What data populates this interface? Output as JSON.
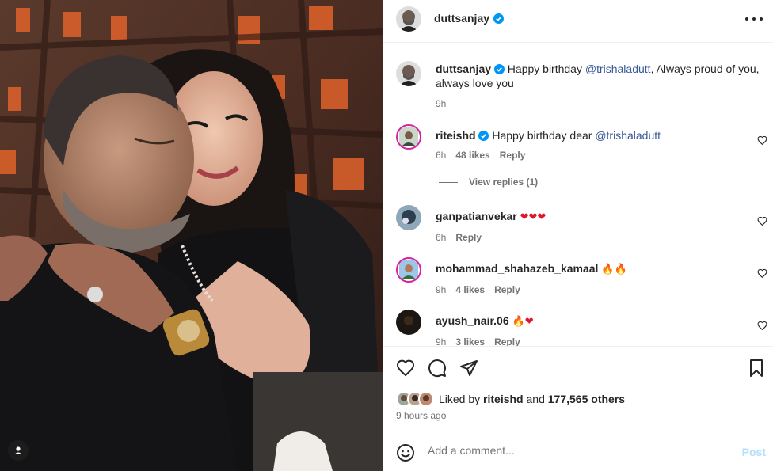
{
  "post": {
    "username": "duttsanjay",
    "verified": true,
    "more_icon": "more-horizontal-icon",
    "media_tag_icon": "user-tag-icon"
  },
  "caption": {
    "username": "duttsanjay",
    "text_before": "Happy birthday",
    "mention": "@trishaladutt",
    "text_after": ", Always proud of you, always love you",
    "time": "9h"
  },
  "comments": [
    {
      "username": "riteishd",
      "verified": true,
      "text": "Happy birthday dear",
      "mention": "@trishaladutt",
      "time": "6h",
      "likes": "48 likes",
      "reply": "Reply"
    },
    {
      "username": "ganpatianvekar",
      "verified": false,
      "text": "❤❤❤",
      "time": "6h",
      "reply": "Reply"
    },
    {
      "username": "mohammad_shahazeb_kamaal",
      "verified": false,
      "text": "🔥🔥",
      "time": "9h",
      "likes": "4 likes",
      "reply": "Reply"
    },
    {
      "username": "ayush_nair.06",
      "verified": false,
      "text_fire": "🔥",
      "text_heart": "❤",
      "time": "9h",
      "likes": "3 likes",
      "reply": "Reply"
    }
  ],
  "view_replies": "View replies (1)",
  "likes": {
    "prefix": "Liked by",
    "user": "riteishd",
    "middle": "and",
    "count": "177,565 others",
    "time_ago": "9 hours ago"
  },
  "add_comment": {
    "placeholder": "Add a comment...",
    "post_label": "Post"
  },
  "colors": {
    "mention": "#385898",
    "verified": "#0095f6",
    "post_disabled": "#b2dffc",
    "story_ring": "#d6249f"
  }
}
